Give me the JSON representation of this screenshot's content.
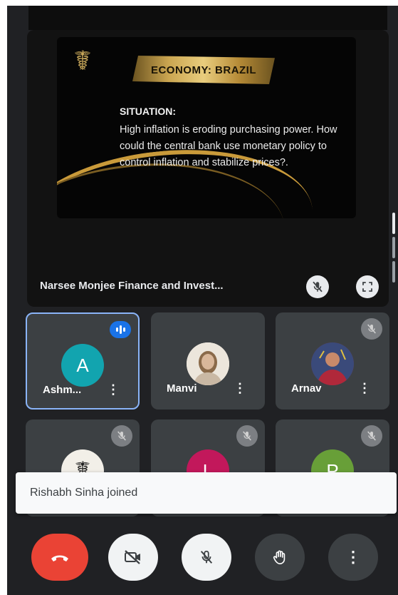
{
  "presentation": {
    "slide": {
      "banner": "ECONOMY: BRAZIL",
      "situation_label": "SITUATION:",
      "situation_text": "High inflation is eroding purchasing power. How could the central bank use monetary policy to control inflation and stabilize prices?."
    },
    "presenter_name": "Narsee Monjee Finance and Invest..."
  },
  "participants": [
    {
      "name": "Ashm...",
      "initial": "A",
      "avatar_color": "#12a4af",
      "speaking": true
    },
    {
      "name": "Manvi",
      "initial": "",
      "avatar_color": "#d8cbb8",
      "speaking": false
    },
    {
      "name": "Arnav",
      "initial": "",
      "avatar_color": "#8a2b38",
      "speaking": false
    },
    {
      "name": "",
      "initial": "",
      "avatar_color": "#f2efe8",
      "speaking": false
    },
    {
      "name": "",
      "initial": "L",
      "avatar_color": "#c2185b",
      "speaking": false
    },
    {
      "name": "",
      "initial": "P",
      "avatar_color": "#689f38",
      "speaking": false
    }
  ],
  "toast": {
    "message": "Rishabh Sinha joined"
  },
  "colors": {
    "end_call": "#ea4335",
    "control_light": "#f1f3f4",
    "control_dark": "#3c4043",
    "accent": "#8ab4f8"
  }
}
